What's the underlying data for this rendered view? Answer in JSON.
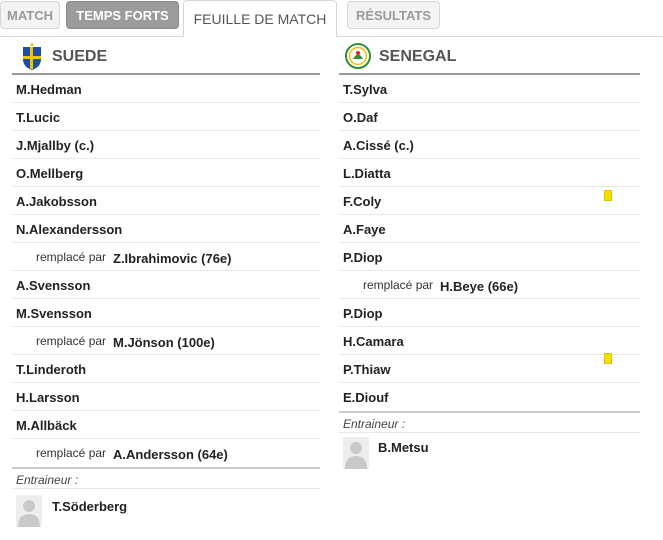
{
  "tabs": {
    "match": "MATCH",
    "temps_forts": "TEMPS FORTS",
    "feuille": "FEUILLE DE MATCH",
    "resultats": "RÉSULTATS"
  },
  "home": {
    "team": "SUEDE",
    "players": [
      "M.Hedman",
      "T.Lucic",
      "J.Mjallby (c.)",
      "O.Mellberg",
      "A.Jakobsson",
      "N.Alexandersson",
      "Z.Ibrahimovic (76e)",
      "A.Svensson",
      "M.Svensson",
      "M.Jönson (100e)",
      "T.Linderoth",
      "H.Larsson",
      "M.Allbäck",
      "A.Andersson (64e)"
    ],
    "replaced_label": "remplacé par",
    "coach_label": "Entraineur :",
    "coach": "T.Söderberg"
  },
  "away": {
    "team": "SENEGAL",
    "players": [
      "T.Sylva",
      "O.Daf",
      "A.Cissé (c.)",
      "L.Diatta",
      "F.Coly",
      "A.Faye",
      "P.Diop",
      "H.Beye (66e)",
      "P.Diop",
      "H.Camara",
      "P.Thiaw",
      "E.Diouf"
    ],
    "replaced_label": "remplacé par",
    "coach_label": "Entraineur :",
    "coach": "B.Metsu"
  },
  "icons": {
    "home_flag": "sweden-federation-crest-icon",
    "away_flag": "senegal-federation-crest-icon",
    "card": "yellow-card-icon",
    "avatar": "person-silhouette-icon"
  },
  "colors": {
    "yellow_card": "#f4e000",
    "sweden_blue": "#1f4ea3",
    "sweden_yellow": "#f2c500",
    "senegal_green": "#2f8f3a"
  }
}
